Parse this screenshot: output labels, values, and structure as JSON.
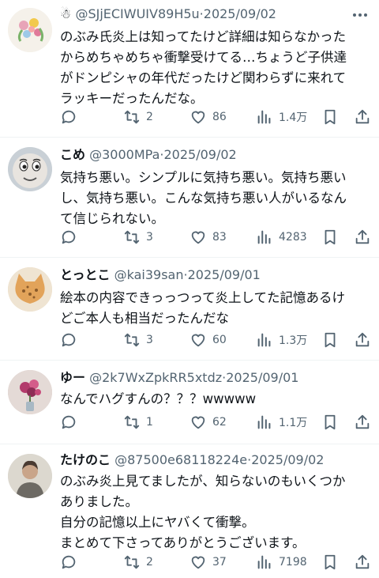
{
  "posts": [
    {
      "name": "☃",
      "handle": "@SJjECIWUIV89H5u",
      "date": "2025/09/02",
      "text": "のぶみ氏炎上は知ってたけど詳細は知らなかった\nからめちゃめちゃ衝撃受けてる…ちょうど子供達\nがドンピシャの年代だったけど関わらずに来れて\nラッキーだったんだな。",
      "replies": "",
      "reposts": "2",
      "likes": "86",
      "views": "1.4万"
    },
    {
      "name": "こめ",
      "handle": "@3000MPa",
      "date": "2025/09/02",
      "text": "気持ち悪い。シンプルに気持ち悪い。気持ち悪い\nし、気持ち悪い。こんな気持ち悪い人がいるなん\nて信じられない。",
      "replies": "",
      "reposts": "3",
      "likes": "83",
      "views": "4283"
    },
    {
      "name": "とっとこ",
      "handle": "@kai39san",
      "date": "2025/09/01",
      "text": "絵本の内容できっっつって炎上してた記憶あるけ\nどご本人も相当だったんだな",
      "replies": "",
      "reposts": "3",
      "likes": "60",
      "views": "1.3万"
    },
    {
      "name": "ゆー",
      "handle": "@2k7WxZpkRR5xtdz",
      "date": "2025/09/01",
      "text": "なんでハグすんの？？？wwwww",
      "replies": "",
      "reposts": "1",
      "likes": "62",
      "views": "1.1万"
    },
    {
      "name": "たけのこ",
      "handle": "@87500e68118224e",
      "date": "2025/09/02",
      "text": "のぶみ炎上見てましたが、知らないのもいくつか\nありました。\n自分の記憶以上にヤバくて衝撃。\nまとめて下さってありがとうございます。",
      "replies": "",
      "reposts": "2",
      "likes": "37",
      "views": "7198"
    }
  ],
  "colors": {
    "text": "#0f1419",
    "secondary": "#536471",
    "divider": "#eff3f4"
  }
}
